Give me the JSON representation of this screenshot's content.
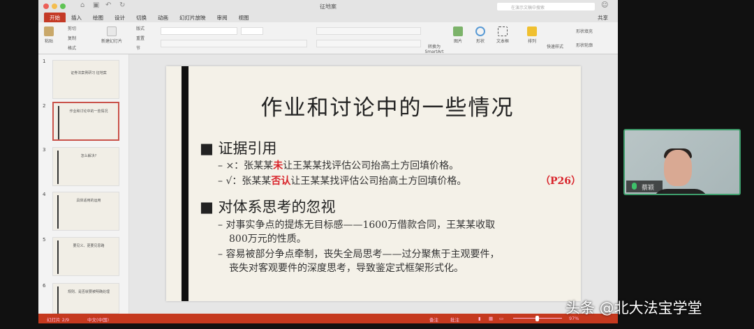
{
  "window": {
    "title": "征地案",
    "search_placeholder": "在演示文稿中搜索",
    "share": "共享"
  },
  "tabs": [
    "开始",
    "插入",
    "绘图",
    "设计",
    "切换",
    "动画",
    "幻灯片放映",
    "审阅",
    "视图"
  ],
  "ribbon": {
    "paste": "粘贴",
    "cut": "剪切",
    "copy": "复制",
    "format": "格式",
    "new_slide": "新建幻灯片",
    "layout": "版式",
    "reset": "重置",
    "section": "节",
    "convert_smartart": "转换为SmartArt",
    "picture": "图片",
    "shape": "形状",
    "textbox": "文本框",
    "arrange": "排列",
    "quick_styles": "快速样式",
    "shape_fill": "形状填充",
    "shape_outline": "形状轮廓"
  },
  "thumbnails": [
    {
      "num": "1",
      "text": "证券法案例研习 征地案"
    },
    {
      "num": "2",
      "text": "作业和讨论中的一些情况"
    },
    {
      "num": "3",
      "text": "怎么解决?"
    },
    {
      "num": "4",
      "text": "具体适用的运用"
    },
    {
      "num": "5",
      "text": "要见义、更要见思路"
    },
    {
      "num": "6",
      "text": "规则、是否就要被明确处理"
    }
  ],
  "slide": {
    "title": "作业和讨论中的一些情况",
    "sections": [
      {
        "heading": "证据引用",
        "items": [
          {
            "prefix": "– ×：张某某",
            "highlight": "未",
            "rest": "让王某某找评估公司抬高土方回填价格。",
            "note": ""
          },
          {
            "prefix": "– √：张某某",
            "highlight": "否认",
            "rest": "让王某某找评估公司抬高土方回填价格。",
            "note": "（P26）"
          }
        ]
      },
      {
        "heading": "对体系思考的忽视",
        "items": [
          {
            "line1": "– 对事实争点的提炼无目标感——1600万借款合同，王某某收取",
            "line2": "800万元的性质。"
          },
          {
            "line1": "– 容易被部分争点牵制，丧失全局思考——过分聚焦于主观要件，",
            "line2": "丧失对客观要件的深度思考，导致鉴定式框架形式化。"
          }
        ]
      }
    ]
  },
  "status": {
    "slide_count": "幻灯片 2/9",
    "language": "中文(中国)",
    "notes": "备注",
    "comments": "批注",
    "zoom": "97%"
  },
  "video": {
    "participant_name": "蔡颖"
  },
  "watermark": "头条 @北大法宝学堂",
  "colors": {
    "accent": "#c43a26",
    "highlight": "#d8232a",
    "video_border": "#3e9e6c"
  }
}
